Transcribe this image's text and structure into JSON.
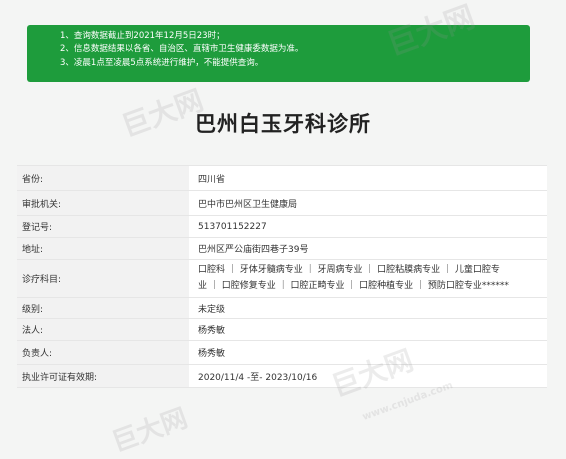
{
  "notice": {
    "lines": [
      "1、查询数据截止到2021年12月5日23时；",
      "2、信息数据结果以各省、自治区、直辖市卫生健康委数据为准。",
      "3、凌晨1点至凌晨5点系统进行维护，不能提供查询。"
    ]
  },
  "title": "巴州白玉牙科诊所",
  "rows": {
    "province": {
      "label": "省份:",
      "value": "四川省"
    },
    "authority": {
      "label": "审批机关:",
      "value": "巴中市巴州区卫生健康局"
    },
    "reg_no": {
      "label": "登记号:",
      "value": "513701152227"
    },
    "address": {
      "label": "地址:",
      "value": "巴州区严公庙街四巷子39号"
    },
    "departments": {
      "label": "诊疗科目:",
      "line1": "口腔科 ｜ 牙体牙髓病专业 ｜ 牙周病专业 ｜ 口腔粘膜病专业 ｜ 儿童口腔专",
      "line2": "业 ｜ 口腔修复专业 ｜ 口腔正畸专业 ｜ 口腔种植专业 ｜ 预防口腔专业******"
    },
    "level": {
      "label": "级别:",
      "value": "未定级"
    },
    "legal_person": {
      "label": "法人:",
      "value": "杨秀敏"
    },
    "person_in_charge": {
      "label": "负责人:",
      "value": "杨秀敏"
    },
    "validity": {
      "label": "执业许可证有效期:",
      "value": "2020/11/4 -至- 2023/10/16"
    }
  },
  "watermarks": {
    "brand": "巨大网",
    "url": "www.cnjuda.com"
  },
  "colors": {
    "notice_bg": "#1e9c3c",
    "label_bg": "#f2f2f2"
  }
}
